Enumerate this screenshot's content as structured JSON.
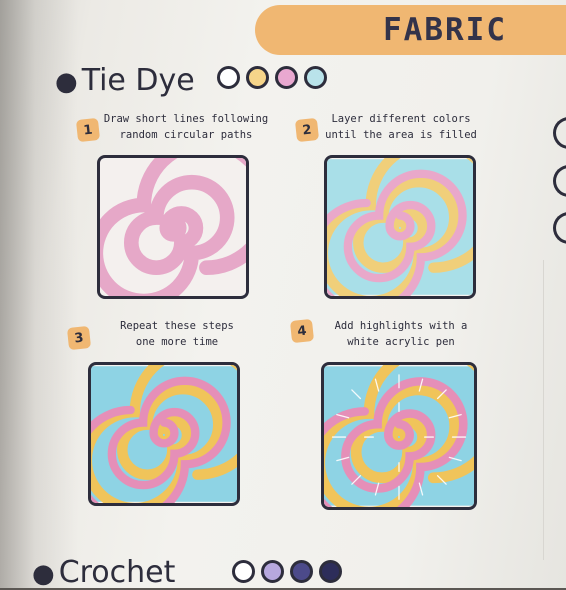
{
  "header": {
    "title": "FABRIC"
  },
  "tie_dye": {
    "title": "Tie Dye",
    "difficulty": {
      "filled": 0,
      "total": 4,
      "colors": [
        "#ffffff",
        "#f6d58a",
        "#e9a8d0",
        "#b9e3ea"
      ]
    },
    "steps": [
      {
        "number": "1",
        "text": "Draw short lines following\nrandom circular paths"
      },
      {
        "number": "2",
        "text": "Layer different colors\nuntil the area is filled"
      },
      {
        "number": "3",
        "text": "Repeat these steps\none more time"
      },
      {
        "number": "4",
        "text": "Add highlights with a\nwhite acrylic pen"
      }
    ]
  },
  "crochet": {
    "title": "Crochet",
    "difficulty": {
      "filled": 2,
      "total": 4,
      "colors": [
        "#ffffff",
        "#b7a8de",
        "#4c4a8a",
        "#2d2d5a"
      ]
    }
  },
  "palette": {
    "ink": "#2d2d3c",
    "orange": "#f0b772",
    "pink": "#e9a3c4",
    "blue": "#8fd6e6",
    "yellow": "#f3cf6a",
    "white": "#f7f5f2"
  }
}
